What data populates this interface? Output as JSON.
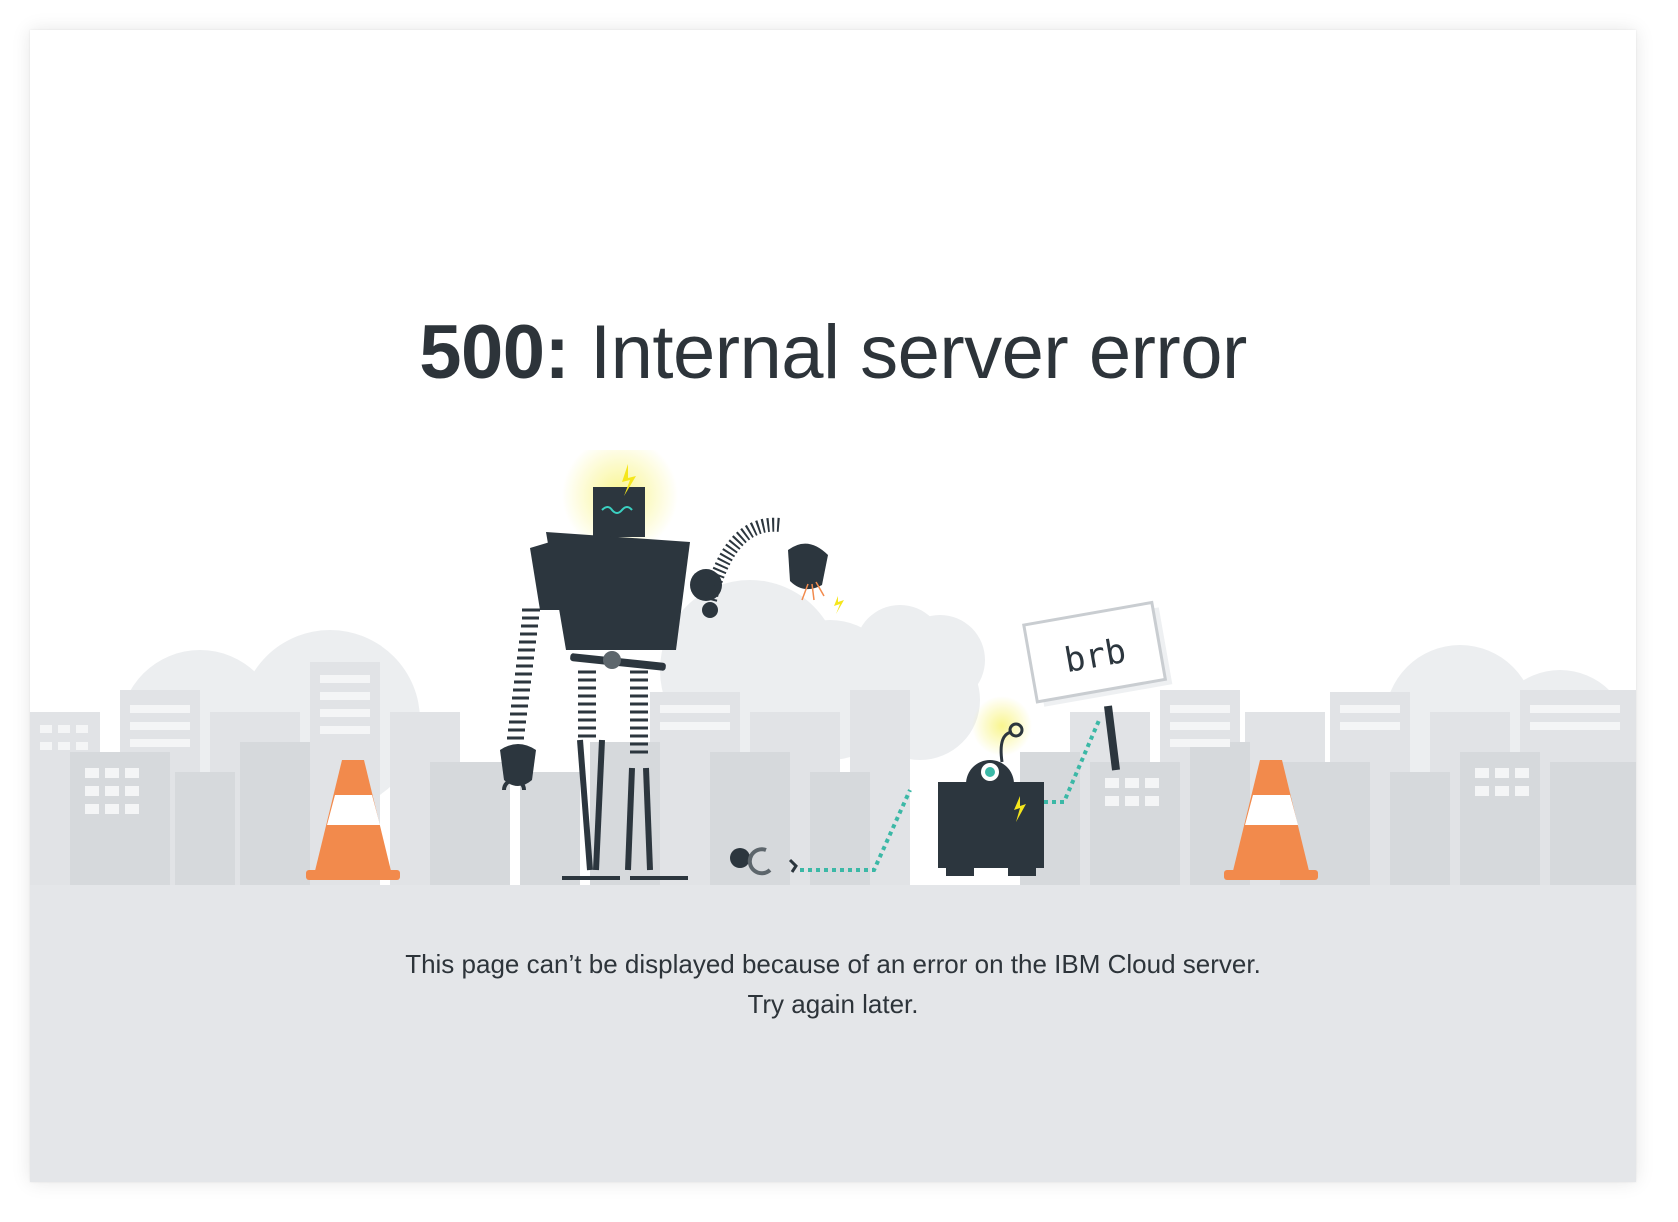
{
  "error": {
    "code": "500:",
    "title": "Internal server error"
  },
  "illustration": {
    "sign_text": "brb",
    "colors": {
      "robot_body": "#2c363e",
      "cone_orange": "#f28a4c",
      "cone_stripe": "#ffffff",
      "cable_teal": "#3bb8a6",
      "spark_yellow": "#f5e61c",
      "city_gray": "#d4d7da",
      "cloud_gray": "#e8eaec",
      "ground_gray": "#e4e6e9"
    }
  },
  "message": {
    "line1": "This page can’t be displayed because of an error on the IBM Cloud server.",
    "line2": "Try again later."
  }
}
